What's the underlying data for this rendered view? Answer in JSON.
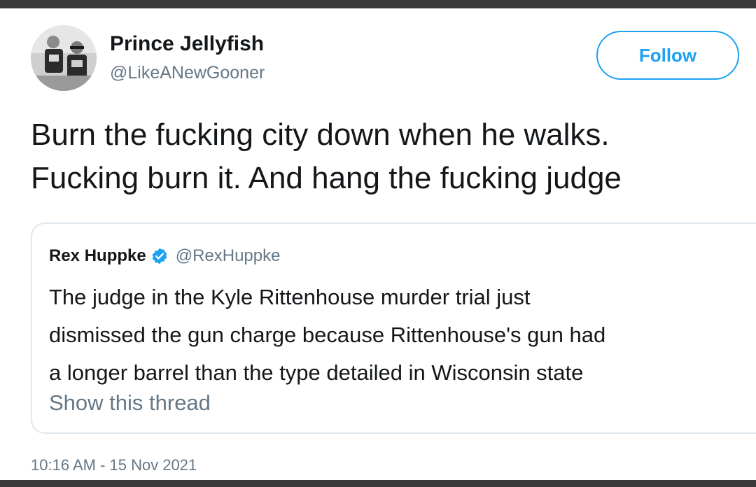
{
  "author": {
    "name": "Prince Jellyfish",
    "handle": "@LikeANewGooner",
    "avatar_icon": "profile-photo-icon"
  },
  "follow_button": {
    "label": "Follow",
    "color": "#1da1f2"
  },
  "tweet": {
    "lines": [
      "Burn the fucking city down when he walks.",
      "Fucking burn it. And hang the fucking judge"
    ]
  },
  "quoted_tweet": {
    "author_name": "Rex Huppke",
    "verified_icon": "verified-badge-icon",
    "handle": "@RexHuppke",
    "lines": [
      "The judge in the Kyle Rittenhouse murder trial just",
      "dismissed the gun charge because Rittenhouse's gun had",
      "a longer barrel than the type detailed in Wisconsin state"
    ],
    "show_thread_label": "Show this thread"
  },
  "timestamp": "10:16 AM - 15 Nov 2021"
}
